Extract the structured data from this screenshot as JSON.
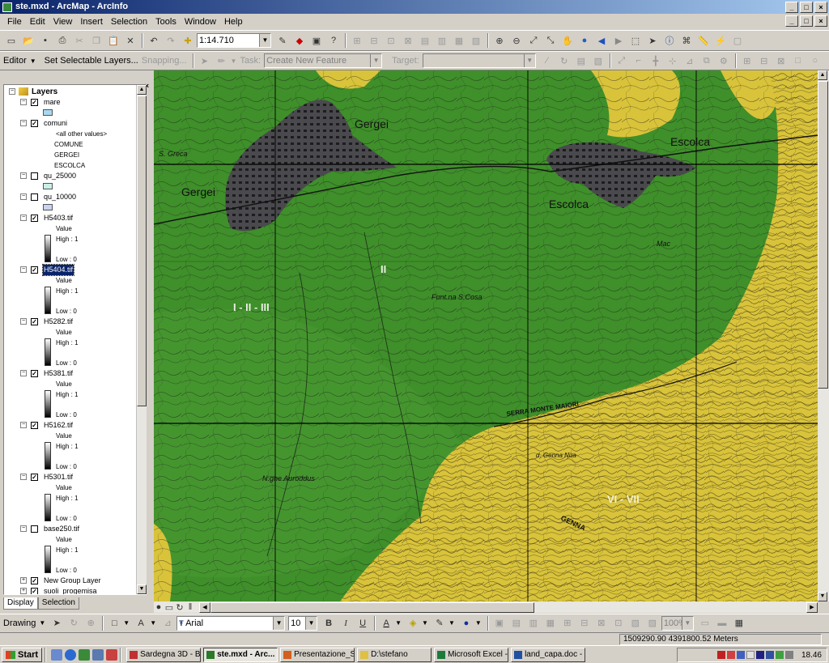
{
  "window": {
    "title": "ste.mxd - ArcMap - ArcInfo",
    "inner_controls": [
      "_",
      "□",
      "×"
    ]
  },
  "menu": [
    "File",
    "Edit",
    "View",
    "Insert",
    "Selection",
    "Tools",
    "Window",
    "Help"
  ],
  "standard_toolbar": {
    "scale": "1:14.710"
  },
  "editor_toolbar": {
    "editor_label": "Editor",
    "set_selectable": "Set Selectable Layers...",
    "snapping": "Snapping...",
    "task_label": "Task:",
    "task_value": "Create New Feature",
    "target_label": "Target:",
    "target_value": ""
  },
  "toc": {
    "root": "Layers",
    "layers": [
      {
        "name": "mare",
        "checked": true,
        "swatch": "#a8d8f0"
      },
      {
        "name": "comuni",
        "checked": true,
        "values": [
          "<all other values>",
          "COMUNE",
          "GERGEI",
          "ESCOLCA"
        ]
      },
      {
        "name": "qu_25000",
        "checked": false,
        "swatch": "#c8f0e8"
      },
      {
        "name": "qu_10000",
        "checked": false,
        "swatch": "#c8d4f0"
      },
      {
        "name": "H5403.tif",
        "checked": true,
        "raster": true
      },
      {
        "name": "H5404.tif",
        "checked": true,
        "raster": true,
        "selected": true
      },
      {
        "name": "H5282.tif",
        "checked": true,
        "raster": true
      },
      {
        "name": "H5381.tif",
        "checked": true,
        "raster": true
      },
      {
        "name": "H5162.tif",
        "checked": true,
        "raster": true
      },
      {
        "name": "H5301.tif",
        "checked": true,
        "raster": true
      },
      {
        "name": "base250.tif",
        "checked": false,
        "raster": true
      },
      {
        "name": "New Group Layer",
        "checked": true,
        "group": true
      },
      {
        "name": "suoli_progemisa",
        "checked": true,
        "group": true
      }
    ],
    "raster_labels": {
      "value": "Value",
      "high": "High : 1",
      "low": "Low : 0"
    },
    "tabs": [
      "Display",
      "Selection"
    ]
  },
  "map": {
    "labels": {
      "gergei_top": "Gergei",
      "gergei_left": "Gergei",
      "escolca_top": "Escolca",
      "escolca_mid": "Escolca",
      "s_greca": "S. Greca",
      "class_1_3": "I - II - III",
      "class_2": "II",
      "class_6_7": "VI - VII",
      "funtana": "Funt.na S.Cosa",
      "serra": "SERRA MONTE MAIORI",
      "nghe": "N.ghe Auroddus",
      "de_genna": "d. Genna Nua",
      "mac": "Mac",
      "genna": "GENNA"
    },
    "colors": {
      "green": "#3f8f2a",
      "yellow": "#d9c33a",
      "urban": "#4a4a4e"
    }
  },
  "drawing_toolbar": {
    "drawing_label": "Drawing",
    "font": "Arial",
    "size": "10",
    "zoom": "100%"
  },
  "status": {
    "coordinates": "1509290.90  4391800.52 Meters"
  },
  "taskbar": {
    "start": "Start",
    "items": [
      {
        "label": "Sardegna 3D - B...",
        "color": "#c03030"
      },
      {
        "label": "ste.mxd - Arc...",
        "color": "#2a7a2a",
        "active": true
      },
      {
        "label": "Presentazione_S...",
        "color": "#d06020"
      },
      {
        "label": "D:\\stefano",
        "color": "#e0c040"
      },
      {
        "label": "Microsoft Excel -...",
        "color": "#1e7a3a"
      },
      {
        "label": "land_capa.doc - ...",
        "color": "#2050a0"
      }
    ],
    "clock": "18.46"
  }
}
